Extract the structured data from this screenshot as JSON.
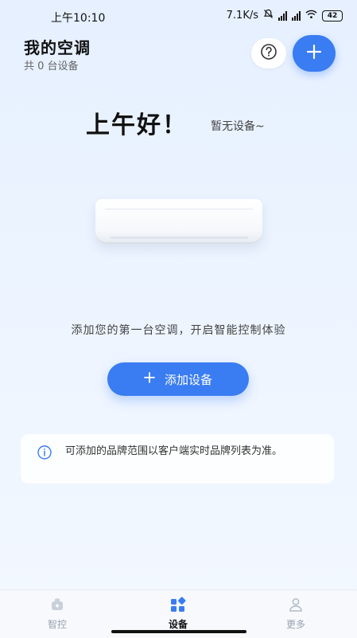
{
  "status_bar": {
    "time": "上午10:10",
    "network_speed": "7.1K/s",
    "battery": "42",
    "icons": [
      "mute-icon",
      "signal-hd-icon",
      "signal-hd-icon",
      "wifi-icon",
      "battery-icon"
    ]
  },
  "header": {
    "title": "我的空调",
    "subtitle": "共 0 台设备",
    "help_icon": "question-circle-icon",
    "add_icon": "plus-icon"
  },
  "greeting": {
    "text": "上午好！",
    "status": "暂无设备~"
  },
  "illustration": "air-conditioner-icon",
  "empty_state": {
    "description": "添加您的第一台空调，开启智能控制体验",
    "add_button_label": "添加设备",
    "add_button_icon": "plus-icon"
  },
  "info": {
    "icon": "info-circle-icon",
    "text": "可添加的品牌范围以客户端实时品牌列表为准。"
  },
  "bottom_nav": {
    "items": [
      {
        "label": "智控",
        "icon": "smart-control-icon",
        "active": false
      },
      {
        "label": "设备",
        "icon": "device-grid-icon",
        "active": true
      },
      {
        "label": "更多",
        "icon": "user-icon",
        "active": false
      }
    ]
  },
  "colors": {
    "accent": "#3a7cf1",
    "inactive": "#9aa3b2",
    "background": "#e6f0ff"
  }
}
